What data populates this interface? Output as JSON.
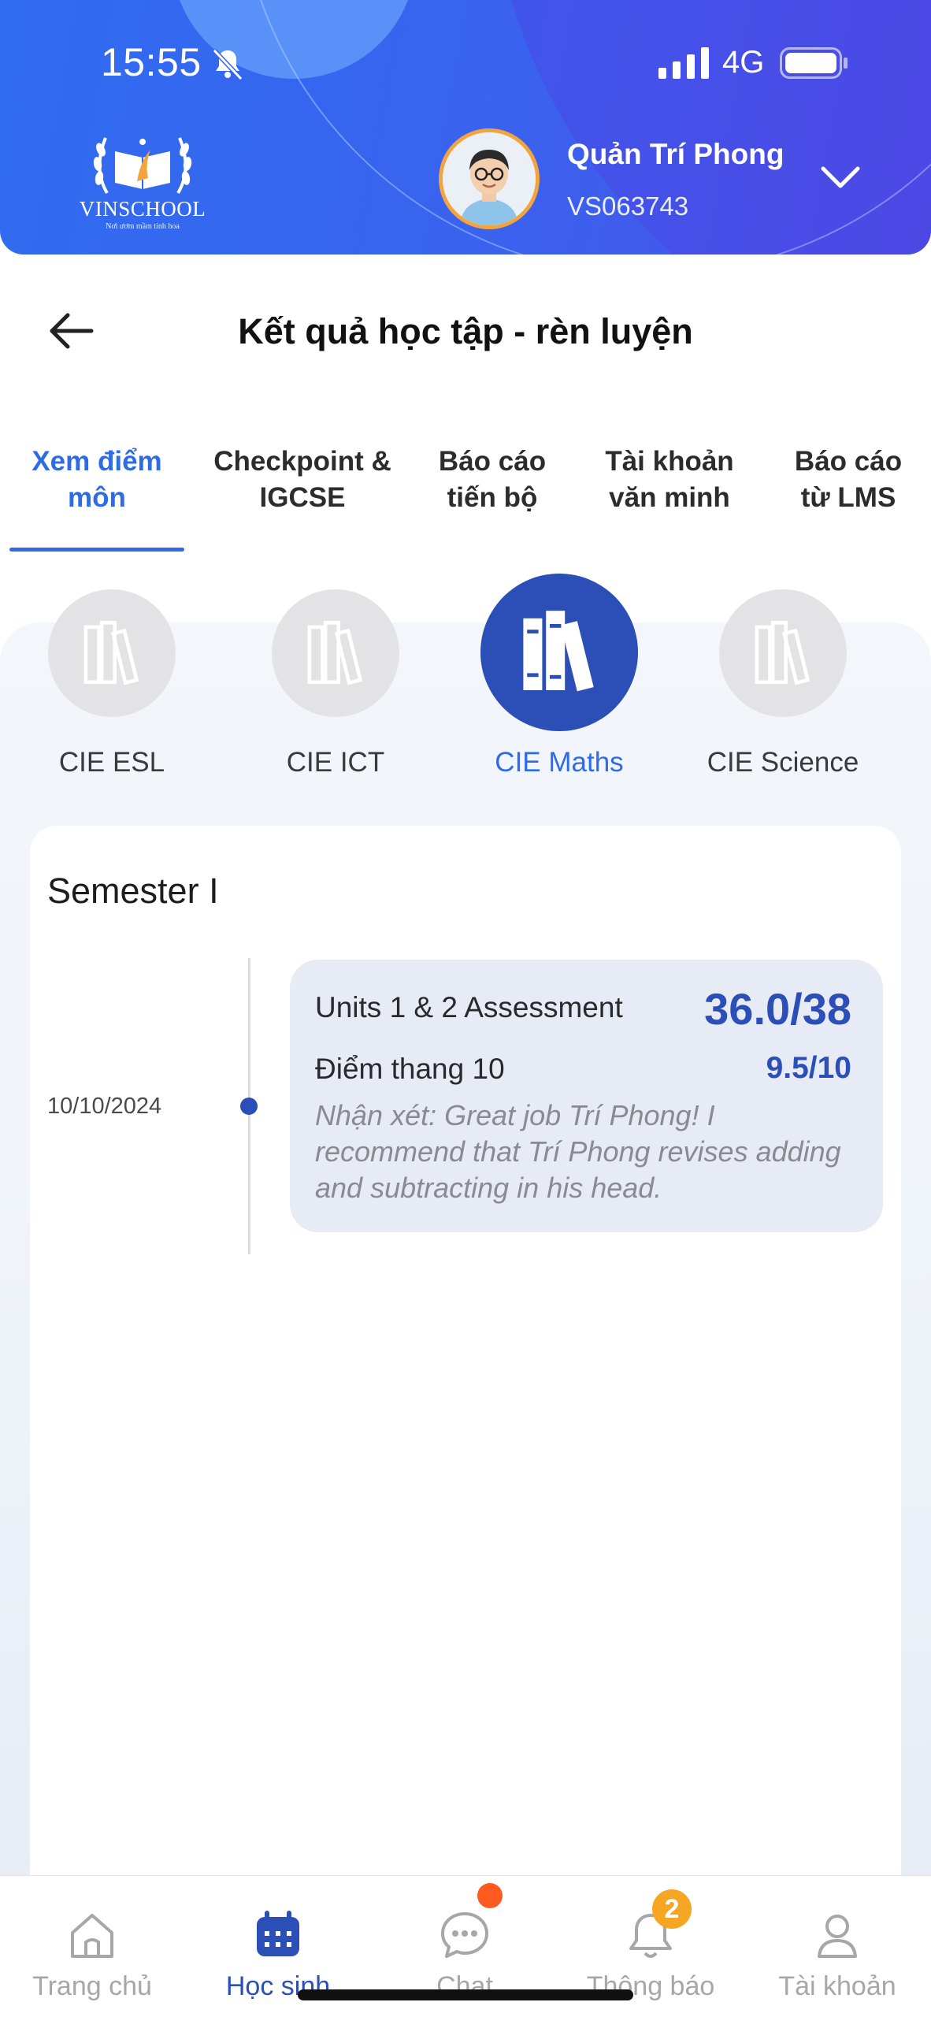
{
  "status_bar": {
    "time": "15:55",
    "network": "4G"
  },
  "header": {
    "logo": {
      "brand": "VINSCHOOL",
      "tagline": "Nơi ươm mầm tinh hoa"
    },
    "user": {
      "name": "Quản Trí Phong",
      "id": "VS063743"
    }
  },
  "page": {
    "title": "Kết quả học tập - rèn luyện"
  },
  "tabs": [
    {
      "label": "Xem điểm môn",
      "active": true
    },
    {
      "label": "Checkpoint & IGCSE",
      "active": false
    },
    {
      "label": "Báo cáo tiến bộ",
      "active": false
    },
    {
      "label": "Tài khoản văn minh",
      "active": false
    },
    {
      "label": "Báo cáo từ LMS",
      "active": false
    }
  ],
  "subjects": [
    {
      "label": "CIE ESL",
      "icon": "books-icon",
      "active": false
    },
    {
      "label": "CIE ICT",
      "icon": "books-icon",
      "active": false
    },
    {
      "label": "CIE Maths",
      "icon": "books-icon",
      "active": true
    },
    {
      "label": "CIE Science",
      "icon": "books-icon",
      "active": false
    }
  ],
  "semester": {
    "title": "Semester I",
    "entries": [
      {
        "date": "10/10/2024",
        "assessment": "Units 1 & 2 Assessment",
        "score": "36.0/38",
        "monthly_label": "Điểm thang 10",
        "monthly_score": "9.5/10",
        "comment": "Nhận xét: Great job Trí Phong! I recommend that Trí Phong revises adding and subtracting in his head."
      }
    ]
  },
  "bottom_nav": [
    {
      "label": "Trang chủ",
      "icon": "home-icon",
      "active": false
    },
    {
      "label": "Học sinh",
      "icon": "calendar-icon",
      "active": true
    },
    {
      "label": "Chat",
      "icon": "chat-icon",
      "active": false
    },
    {
      "label": "Thông báo",
      "icon": "bell-icon",
      "active": false,
      "badge": "2"
    },
    {
      "label": "Tài khoản",
      "icon": "user-icon",
      "active": false
    }
  ],
  "colors": {
    "accent": "#2e6be6",
    "primary_dark": "#2b4fb6",
    "header": "#3a62ee",
    "badge": "#f6a623",
    "dot": "#ff5a1f"
  }
}
